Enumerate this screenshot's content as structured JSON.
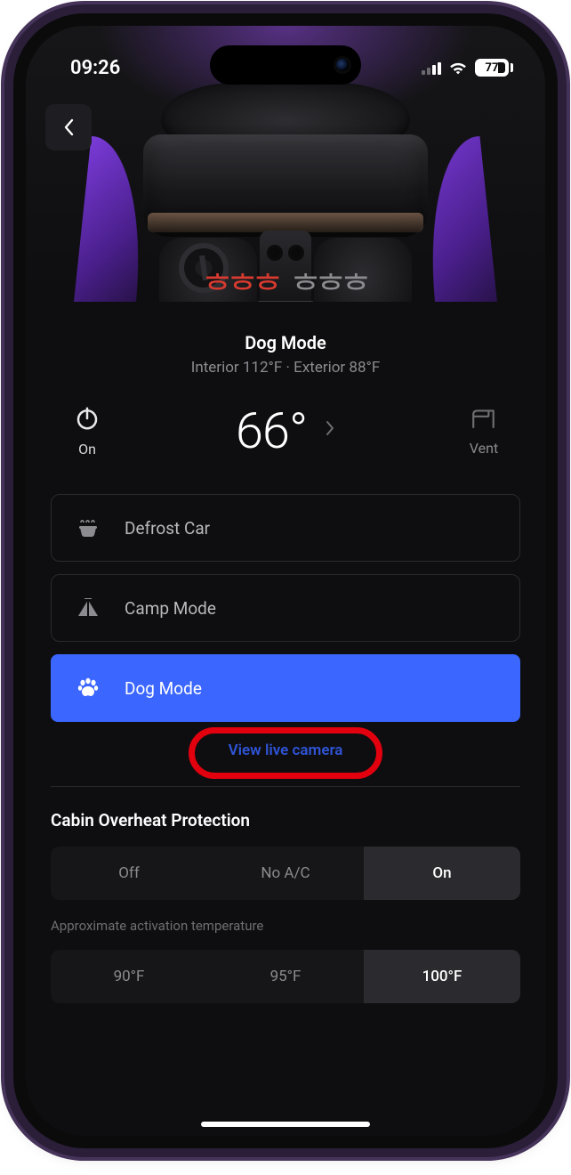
{
  "status": {
    "time": "09:26",
    "battery": "77"
  },
  "hero": {
    "driver_seat_heat_icon": "heat-waves",
    "passenger_seat_heat_icon": "heat-waves"
  },
  "climate": {
    "mode_title": "Dog Mode",
    "temps_line": "Interior 112°F  ·  Exterior 88°F",
    "power_label": "On",
    "target_temp": "66°",
    "vent_label": "Vent"
  },
  "modes": [
    {
      "icon": "defrost-icon",
      "label": "Defrost Car",
      "selected": false
    },
    {
      "icon": "tent-icon",
      "label": "Camp Mode",
      "selected": false
    },
    {
      "icon": "paw-icon",
      "label": "Dog Mode",
      "selected": true
    }
  ],
  "live_camera_label": "View live camera",
  "overheat": {
    "title": "Cabin Overheat Protection",
    "options": [
      "Off",
      "No A/C",
      "On"
    ],
    "selected": "On",
    "sub_label": "Approximate activation temperature",
    "temps": [
      "90°F",
      "95°F",
      "100°F"
    ],
    "temp_selected": "100°F"
  },
  "colors": {
    "accent": "#3b66ff",
    "link": "#2f54d6",
    "heat_on": "#d83a2f",
    "annotation": "#e2000f"
  }
}
